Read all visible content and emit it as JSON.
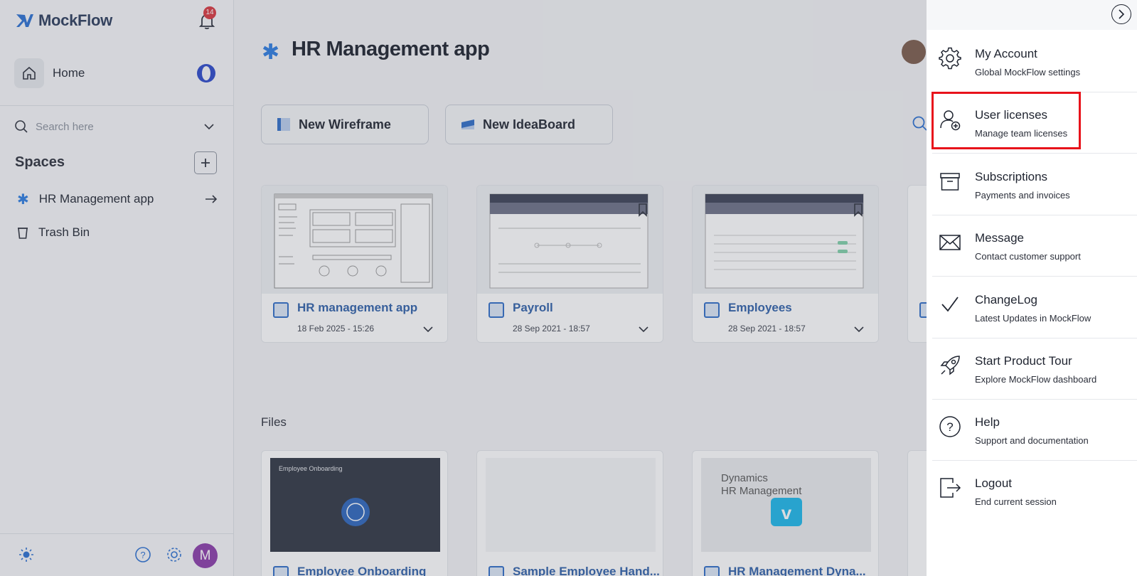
{
  "app": {
    "name": "MockFlow",
    "notifications": "14"
  },
  "sidebar": {
    "home_label": "Home",
    "search_placeholder": "Search here",
    "spaces_title": "Spaces",
    "spaces": [
      {
        "label": "HR Management app"
      },
      {
        "label": "Trash Bin"
      }
    ],
    "avatar_initial": "M"
  },
  "main": {
    "title": "HR Management app",
    "new_wireframe": "New Wireframe",
    "new_ideaboard": "New IdeaBoard",
    "cards": [
      {
        "title": "HR management app",
        "date": "18 Feb 2025 - 15:26"
      },
      {
        "title": "Payroll",
        "date": "28 Sep 2021 - 18:57"
      },
      {
        "title": "Employees",
        "date": "28 Sep 2021 - 18:57"
      }
    ],
    "files_label": "Files",
    "files": [
      {
        "title": "Employee Onboarding",
        "thumb_text": "Employee Onboarding"
      },
      {
        "title": "Sample Employee Hand..."
      },
      {
        "title": "HR Management Dyna...",
        "thumb_text_1": "Dynamics",
        "thumb_text_2": "HR Management"
      }
    ]
  },
  "menu": {
    "items": [
      {
        "title": "My Account",
        "sub": "Global MockFlow settings",
        "icon": "gear-icon"
      },
      {
        "title": "User licenses",
        "sub": "Manage team licenses",
        "icon": "user-plus-icon"
      },
      {
        "title": "Subscriptions",
        "sub": "Payments and invoices",
        "icon": "archive-box-icon"
      },
      {
        "title": "Message",
        "sub": "Contact customer support",
        "icon": "envelope-icon"
      },
      {
        "title": "ChangeLog",
        "sub": "Latest Updates in MockFlow",
        "icon": "check-icon"
      },
      {
        "title": "Start Product Tour",
        "sub": "Explore MockFlow dashboard",
        "icon": "rocket-icon"
      },
      {
        "title": "Help",
        "sub": "Support and documentation",
        "icon": "question-icon"
      },
      {
        "title": "Logout",
        "sub": "End current session",
        "icon": "logout-icon"
      }
    ]
  },
  "colors": {
    "accent": "#2e6cc7",
    "highlight": "#e8131b",
    "badge": "#d9363e"
  }
}
